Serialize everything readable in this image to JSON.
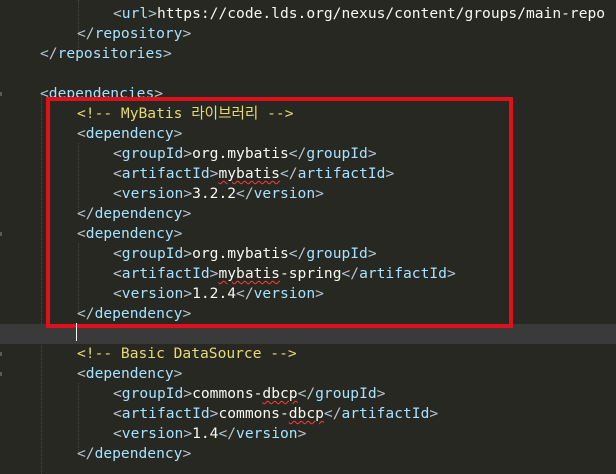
{
  "editor": {
    "lines": [
      {
        "tokens": [
          {
            "c": "br",
            "t": "<"
          },
          {
            "c": "tag",
            "t": "url"
          },
          {
            "c": "br",
            "t": ">"
          },
          {
            "c": "txt",
            "t": "https://code.lds.org/nexus/content/groups/main-repo"
          }
        ]
      },
      {
        "tokens": [
          {
            "c": "br",
            "t": "</"
          },
          {
            "c": "tag",
            "t": "repository"
          },
          {
            "c": "br",
            "t": ">"
          }
        ]
      },
      {
        "tokens": [
          {
            "c": "br",
            "t": "</"
          },
          {
            "c": "tag",
            "t": "repositories"
          },
          {
            "c": "br",
            "t": ">"
          }
        ]
      },
      {
        "tokens": []
      },
      {
        "tokens": [
          {
            "c": "br",
            "t": "<"
          },
          {
            "c": "tag",
            "t": "dependencies"
          },
          {
            "c": "br",
            "t": ">"
          }
        ]
      },
      {
        "tokens": [
          {
            "c": "com",
            "t": "<!-- MyBatis 라이브러리 -->"
          }
        ]
      },
      {
        "tokens": [
          {
            "c": "br",
            "t": "<"
          },
          {
            "c": "tag",
            "t": "dependency"
          },
          {
            "c": "br",
            "t": ">"
          }
        ]
      },
      {
        "tokens": [
          {
            "c": "br",
            "t": "<"
          },
          {
            "c": "tag",
            "t": "groupId"
          },
          {
            "c": "br",
            "t": ">"
          },
          {
            "c": "txt",
            "t": "org.mybatis"
          },
          {
            "c": "br",
            "t": "</"
          },
          {
            "c": "tag",
            "t": "groupId"
          },
          {
            "c": "br",
            "t": ">"
          }
        ]
      },
      {
        "tokens": [
          {
            "c": "br",
            "t": "<"
          },
          {
            "c": "tag",
            "t": "artifactId"
          },
          {
            "c": "br",
            "t": ">"
          },
          {
            "c": "txt sq",
            "t": "mybatis"
          },
          {
            "c": "br",
            "t": "</"
          },
          {
            "c": "tag",
            "t": "artifactId"
          },
          {
            "c": "br",
            "t": ">"
          }
        ]
      },
      {
        "tokens": [
          {
            "c": "br",
            "t": "<"
          },
          {
            "c": "tag",
            "t": "version"
          },
          {
            "c": "br",
            "t": ">"
          },
          {
            "c": "txt",
            "t": "3.2.2"
          },
          {
            "c": "br",
            "t": "</"
          },
          {
            "c": "tag",
            "t": "version"
          },
          {
            "c": "br",
            "t": ">"
          }
        ]
      },
      {
        "tokens": [
          {
            "c": "br",
            "t": "</"
          },
          {
            "c": "tag",
            "t": "dependency"
          },
          {
            "c": "br",
            "t": ">"
          }
        ]
      },
      {
        "tokens": [
          {
            "c": "br",
            "t": "<"
          },
          {
            "c": "tag",
            "t": "dependency"
          },
          {
            "c": "br",
            "t": ">"
          }
        ]
      },
      {
        "tokens": [
          {
            "c": "br",
            "t": "<"
          },
          {
            "c": "tag",
            "t": "groupId"
          },
          {
            "c": "br",
            "t": ">"
          },
          {
            "c": "txt",
            "t": "org.mybatis"
          },
          {
            "c": "br",
            "t": "</"
          },
          {
            "c": "tag",
            "t": "groupId"
          },
          {
            "c": "br",
            "t": ">"
          }
        ]
      },
      {
        "tokens": [
          {
            "c": "br",
            "t": "<"
          },
          {
            "c": "tag",
            "t": "artifactId"
          },
          {
            "c": "br",
            "t": ">"
          },
          {
            "c": "txt sq",
            "t": "mybatis"
          },
          {
            "c": "txt",
            "t": "-spring"
          },
          {
            "c": "br",
            "t": "</"
          },
          {
            "c": "tag",
            "t": "artifactId"
          },
          {
            "c": "br",
            "t": ">"
          }
        ]
      },
      {
        "tokens": [
          {
            "c": "br",
            "t": "<"
          },
          {
            "c": "tag",
            "t": "version"
          },
          {
            "c": "br",
            "t": ">"
          },
          {
            "c": "txt",
            "t": "1.2.4"
          },
          {
            "c": "br",
            "t": "</"
          },
          {
            "c": "tag",
            "t": "version"
          },
          {
            "c": "br",
            "t": ">"
          }
        ]
      },
      {
        "tokens": [
          {
            "c": "br",
            "t": "</"
          },
          {
            "c": "tag",
            "t": "dependency"
          },
          {
            "c": "br",
            "t": ">"
          }
        ]
      },
      {
        "tokens": []
      },
      {
        "tokens": [
          {
            "c": "com",
            "t": "<!-- Basic DataSource -->"
          }
        ]
      },
      {
        "tokens": [
          {
            "c": "br",
            "t": "<"
          },
          {
            "c": "tag",
            "t": "dependency"
          },
          {
            "c": "br",
            "t": ">"
          }
        ]
      },
      {
        "tokens": [
          {
            "c": "br",
            "t": "<"
          },
          {
            "c": "tag",
            "t": "groupId"
          },
          {
            "c": "br",
            "t": ">"
          },
          {
            "c": "txt",
            "t": "commons-"
          },
          {
            "c": "txt sq",
            "t": "dbcp"
          },
          {
            "c": "br",
            "t": "</"
          },
          {
            "c": "tag",
            "t": "groupId"
          },
          {
            "c": "br",
            "t": ">"
          }
        ]
      },
      {
        "tokens": [
          {
            "c": "br",
            "t": "<"
          },
          {
            "c": "tag",
            "t": "artifactId"
          },
          {
            "c": "br",
            "t": ">"
          },
          {
            "c": "txt",
            "t": "commons-"
          },
          {
            "c": "txt sq",
            "t": "dbcp"
          },
          {
            "c": "br",
            "t": "</"
          },
          {
            "c": "tag",
            "t": "artifactId"
          },
          {
            "c": "br",
            "t": ">"
          }
        ]
      },
      {
        "tokens": [
          {
            "c": "br",
            "t": "<"
          },
          {
            "c": "tag",
            "t": "version"
          },
          {
            "c": "br",
            "t": ">"
          },
          {
            "c": "txt",
            "t": "1.4"
          },
          {
            "c": "br",
            "t": "</"
          },
          {
            "c": "tag",
            "t": "version"
          },
          {
            "c": "br",
            "t": ">"
          }
        ]
      },
      {
        "tokens": [
          {
            "c": "br",
            "t": "</"
          },
          {
            "c": "tag",
            "t": "dependency"
          },
          {
            "c": "br",
            "t": ">"
          }
        ]
      }
    ],
    "current_line": 16,
    "highlight_color": "#e0101a",
    "colors": {
      "background": "#272822",
      "tag": "#a6e2ff",
      "bracket": "#b8c4cf",
      "comment": "#e6db74",
      "text": "#f8f8f2"
    }
  }
}
